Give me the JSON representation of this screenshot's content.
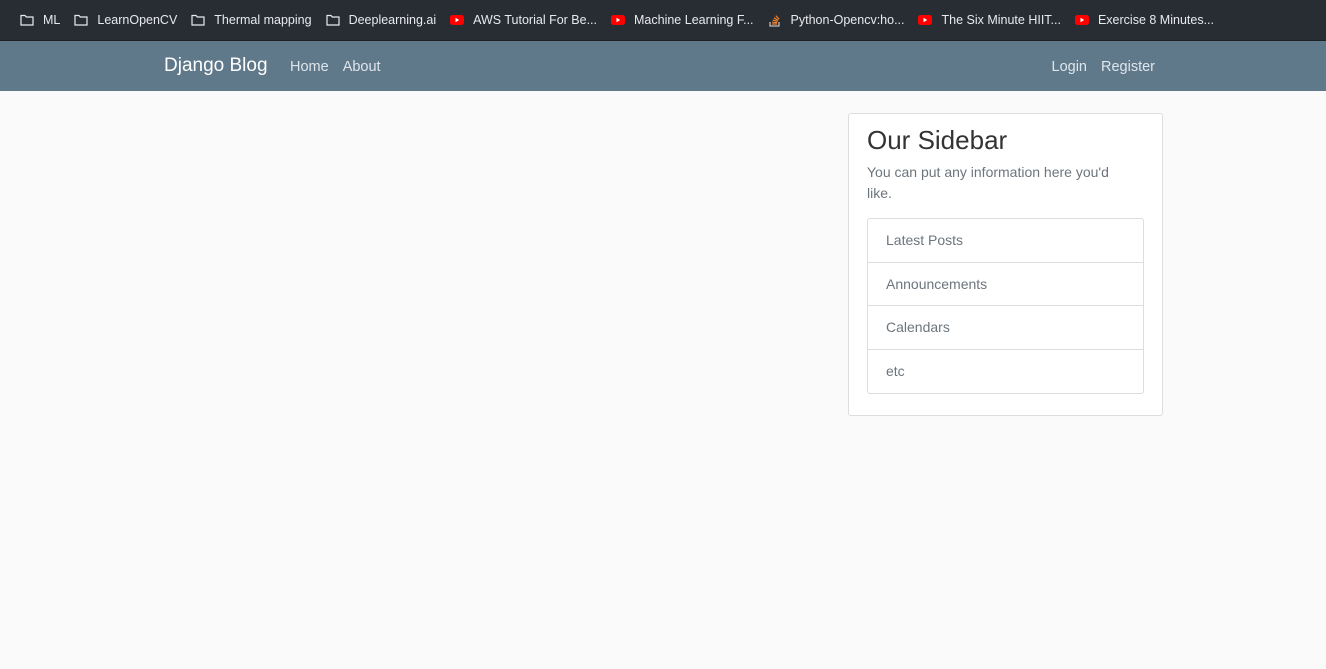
{
  "bookmarks": [
    {
      "label": "ML",
      "icon": "folder-icon"
    },
    {
      "label": "LearnOpenCV",
      "icon": "folder-icon"
    },
    {
      "label": "Thermal mapping",
      "icon": "folder-icon"
    },
    {
      "label": "Deeplearning.ai",
      "icon": "folder-icon"
    },
    {
      "label": "AWS Tutorial For Be...",
      "icon": "youtube-icon"
    },
    {
      "label": "Machine Learning F...",
      "icon": "youtube-icon"
    },
    {
      "label": "Python-Opencv:ho...",
      "icon": "stackoverflow-icon"
    },
    {
      "label": "The Six Minute HIIT...",
      "icon": "youtube-icon"
    },
    {
      "label": "Exercise 8 Minutes...",
      "icon": "youtube-icon"
    }
  ],
  "navbar": {
    "brand": "Django Blog",
    "left_links": [
      "Home",
      "About"
    ],
    "right_links": [
      "Login",
      "Register"
    ]
  },
  "sidebar": {
    "title": "Our Sidebar",
    "text": "You can put any information here you'd like.",
    "items": [
      "Latest Posts",
      "Announcements",
      "Calendars",
      "etc"
    ]
  },
  "colors": {
    "bookmarks_bar": "#282d33",
    "navbar": "#5f788a",
    "page_background": "#fafafa",
    "youtube_red": "#ff0000"
  }
}
